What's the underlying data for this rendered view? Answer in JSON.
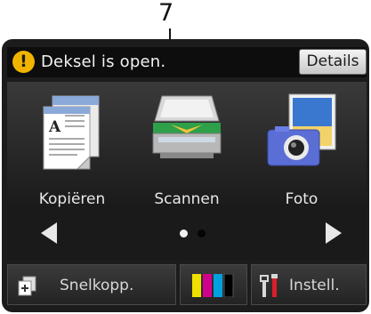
{
  "callout": {
    "number": "7"
  },
  "status": {
    "message": "Deksel is open.",
    "icon": "warning-icon",
    "details_label": "Details",
    "warning_color": "#f0b400"
  },
  "tiles": [
    {
      "label": "Kopiëren",
      "icon": "copy-icon"
    },
    {
      "label": "Scannen",
      "icon": "scanner-icon"
    },
    {
      "label": "Foto",
      "icon": "camera-photo-icon"
    }
  ],
  "pager": {
    "current_page": 1,
    "total_pages": 2
  },
  "bottom": {
    "shortcuts_label": "Snelkopp.",
    "settings_label": "Instell.",
    "ink_colors": [
      "#f0e000",
      "#d0008c",
      "#00a0e0",
      "#000000"
    ]
  }
}
